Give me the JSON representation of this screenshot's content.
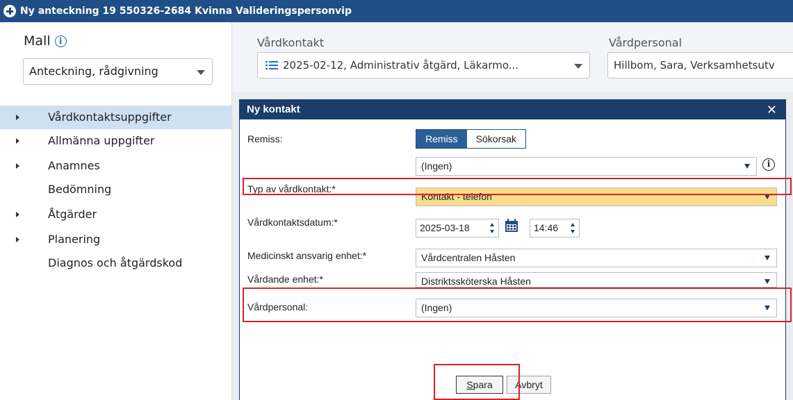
{
  "window": {
    "title": "Ny anteckning 19 550326-2684 Kvinna Valideringspersonvip"
  },
  "sidebar": {
    "mall_label": "Mall",
    "mall_select_value": "Anteckning, rådgivning",
    "items": [
      {
        "label": "Vårdkontaktsuppgifter",
        "expandable": true,
        "active": true
      },
      {
        "label": "Allmänna uppgifter",
        "expandable": true
      },
      {
        "label": "Anamnes",
        "expandable": true
      },
      {
        "label": "Bedömning",
        "expandable": false
      },
      {
        "label": "Åtgärder",
        "expandable": true
      },
      {
        "label": "Planering",
        "expandable": true
      },
      {
        "label": "Diagnos och åtgärdskod",
        "expandable": false
      }
    ]
  },
  "header": {
    "vardkontakt_label": "Vårdkontakt",
    "vardkontakt_value": "2025-02-12, Administrativ åtgärd, Läkarmo...",
    "vardpersonal_label": "Vårdpersonal",
    "vardpersonal_value": "Hillbom, Sara, Verksamhetsutv"
  },
  "dialog": {
    "title": "Ny kontakt",
    "close_glyph": "✕",
    "remiss_label": "Remiss:",
    "toggle_remiss": "Remiss",
    "toggle_sokorsak": "Sökorsak",
    "remiss_value": "(Ingen)",
    "typ_label": "Typ av vårdkontakt:*",
    "typ_value": "Kontakt - telefon",
    "datum_label": "Vårdkontaktsdatum:*",
    "datum_value": "2025-03-18",
    "time_value": "14:46",
    "med_label": "Medicinskt ansvarig enhet:*",
    "med_value": "Vårdcentralen Håsten",
    "vardande_label": "Vårdande enhet:*",
    "vardande_value": "Distriktssköterska Håsten",
    "personal_label": "Vårdpersonal:",
    "personal_value": "(Ingen)",
    "save_rest": "para",
    "save_accel": "S",
    "cancel_label": "Avbryt"
  },
  "colors": {
    "titlebar": "#1f4f86",
    "dialog_title": "#1c3d6b",
    "highlight": "#f9dc8c",
    "annotation": "#e02020",
    "active_nav": "#cfe0f3"
  }
}
